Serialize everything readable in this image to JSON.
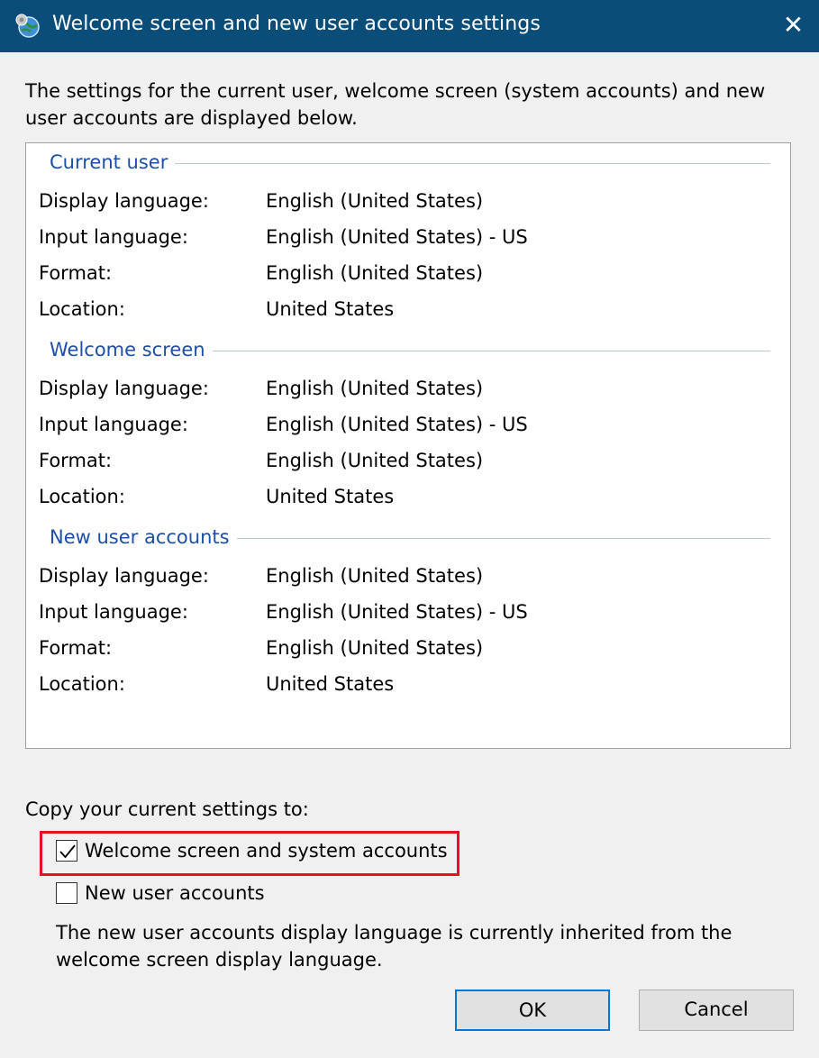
{
  "window": {
    "title": "Welcome screen and new user accounts settings",
    "close_glyph": "✕",
    "title_bar_color": "#0a4d79",
    "icon": "globe-settings-icon"
  },
  "intro_text": "The settings for the current user, welcome screen (system accounts) and new user accounts are displayed below.",
  "sections": [
    {
      "heading": "Current user",
      "rows": [
        {
          "label": "Display language:",
          "value": "English (United States)"
        },
        {
          "label": "Input language:",
          "value": "English (United States) - US"
        },
        {
          "label": "Format:",
          "value": "English (United States)"
        },
        {
          "label": "Location:",
          "value": "United States"
        }
      ]
    },
    {
      "heading": "Welcome screen",
      "rows": [
        {
          "label": "Display language:",
          "value": "English (United States)"
        },
        {
          "label": "Input language:",
          "value": "English (United States) - US"
        },
        {
          "label": "Format:",
          "value": "English (United States)"
        },
        {
          "label": "Location:",
          "value": "United States"
        }
      ]
    },
    {
      "heading": "New user accounts",
      "rows": [
        {
          "label": "Display language:",
          "value": "English (United States)"
        },
        {
          "label": "Input language:",
          "value": "English (United States) - US"
        },
        {
          "label": "Format:",
          "value": "English (United States)"
        },
        {
          "label": "Location:",
          "value": "United States"
        }
      ]
    }
  ],
  "copy": {
    "label": "Copy your current settings to:",
    "welcome_checkbox": {
      "label": "Welcome screen and system accounts",
      "checked": true
    },
    "new_user_checkbox": {
      "label": "New user accounts",
      "checked": false
    },
    "note": "The new user accounts display language is currently inherited from the welcome screen display language.",
    "highlight_color": "#e81123"
  },
  "buttons": {
    "ok": "OK",
    "cancel": "Cancel",
    "accent": "#0078d7"
  }
}
